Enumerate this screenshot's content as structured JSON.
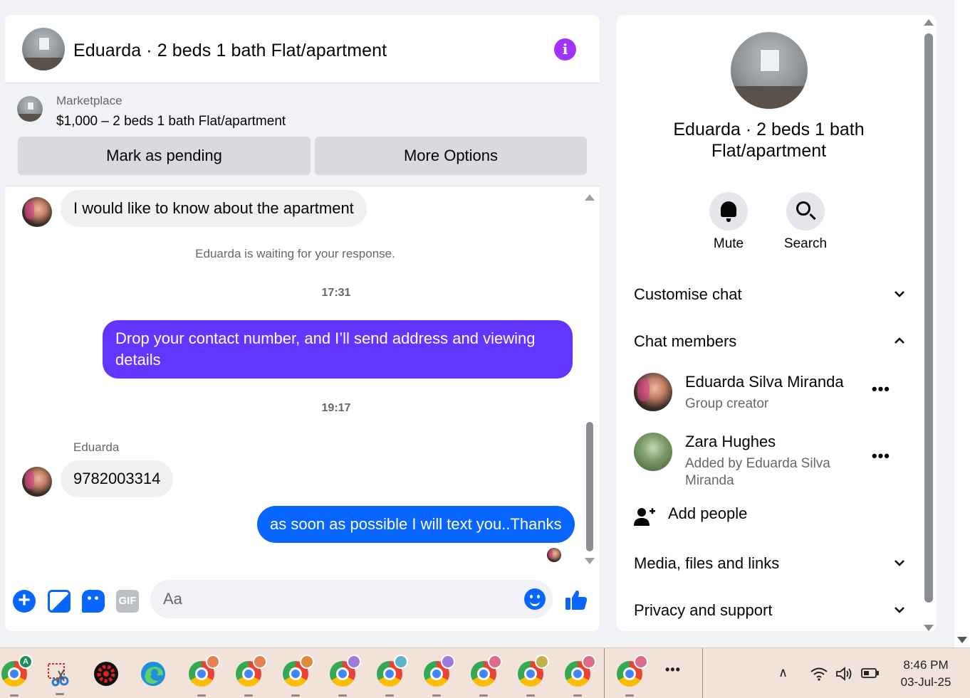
{
  "chat": {
    "title": "Eduarda · 2 beds 1 bath Flat/apartment",
    "info_icon": "i",
    "marketplace_label": "Marketplace",
    "listing": "$1,000 – 2 beds 1 bath Flat/apartment",
    "mark_pending_label": "Mark as pending",
    "more_options_label": "More Options"
  },
  "messages": {
    "incoming_1": "I would like to know about the apartment",
    "waiting_note": "Eduarda is waiting for your response.",
    "time_1": "17:31",
    "outgoing_1": "Drop your contact number, and I’ll send address and viewing details",
    "time_2": "19:17",
    "sender_name": "Eduarda",
    "incoming_2": "9782003314",
    "outgoing_2": "as soon as possible I will text you..Thanks"
  },
  "composer": {
    "placeholder": "Aa",
    "plus_icon": "+",
    "gif_label": "GIF"
  },
  "info_panel": {
    "title": "Eduarda · 2 beds 1 bath Flat/apartment",
    "mute_label": "Mute",
    "search_label": "Search",
    "customise_chat": "Customise chat",
    "chat_members": "Chat members",
    "members": [
      {
        "name": "Eduarda Silva Miranda",
        "subtitle": "Group creator",
        "more": "•••"
      },
      {
        "name": "Zara Hughes",
        "subtitle": "Added by Eduarda Silva Miranda",
        "more": "•••"
      }
    ],
    "add_people": "Add people",
    "media_files_links": "Media, files and links",
    "privacy_support": "Privacy and support",
    "chevron_down": "⌄",
    "chevron_up": "⌃"
  },
  "taskbar": {
    "time": "8:46 PM",
    "date": "03-Jul-25",
    "more_icon": "•••",
    "tray_chevron": "∧",
    "profile_badge_letter": "A",
    "badge_colors": [
      "#e8804f",
      "#e8804f",
      "#e08a3a",
      "#a07ad8",
      "#5fb4c4",
      "#a07ad8",
      "#e06a8a",
      "#c4b04a",
      "#e06a8a",
      "#e06a8a"
    ]
  },
  "colors": {
    "accent_purple": "#a033ff",
    "outgoing_purple": "#6236ff",
    "messenger_blue": "#0866ff"
  }
}
